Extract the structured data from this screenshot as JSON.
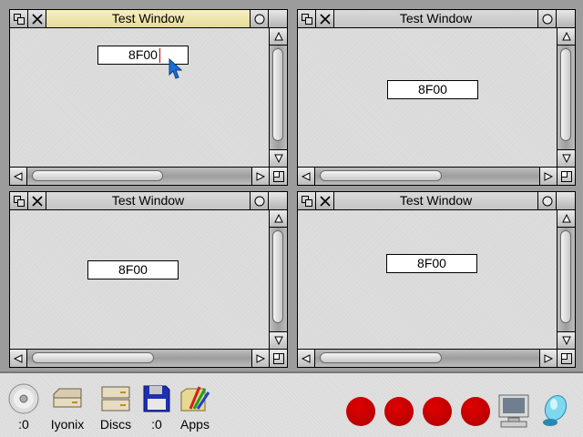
{
  "windows": [
    {
      "id": "win-1",
      "title": "Test Window",
      "field_value": "8F00",
      "focused": true
    },
    {
      "id": "win-2",
      "title": "Test Window",
      "field_value": "8F00",
      "focused": false
    },
    {
      "id": "win-3",
      "title": "Test Window",
      "field_value": "8F00",
      "focused": false
    },
    {
      "id": "win-4",
      "title": "Test Window",
      "field_value": "8F00",
      "focused": false
    }
  ],
  "iconbar": {
    "items": [
      {
        "name": "cd-drive",
        "icon": "cd-disc-icon",
        "label": ":0"
      },
      {
        "name": "iyonix",
        "icon": "hard-disc-icon",
        "label": "Iyonix"
      },
      {
        "name": "discs",
        "icon": "disc-drives-icon",
        "label": "Discs"
      },
      {
        "name": "floppy",
        "icon": "floppy-disk-icon",
        "label": ":0"
      },
      {
        "name": "apps",
        "icon": "apps-icon",
        "label": "Apps"
      }
    ],
    "status_icons": [
      "red-circle-icon",
      "red-circle-icon",
      "red-circle-icon",
      "red-circle-icon"
    ],
    "right_icons": [
      "monitor-icon",
      "acorn-icon"
    ]
  },
  "colors": {
    "focused_title": "#e6dc98",
    "indicator_red": "#c00000",
    "pointer_blue": "#1a6fd8"
  }
}
